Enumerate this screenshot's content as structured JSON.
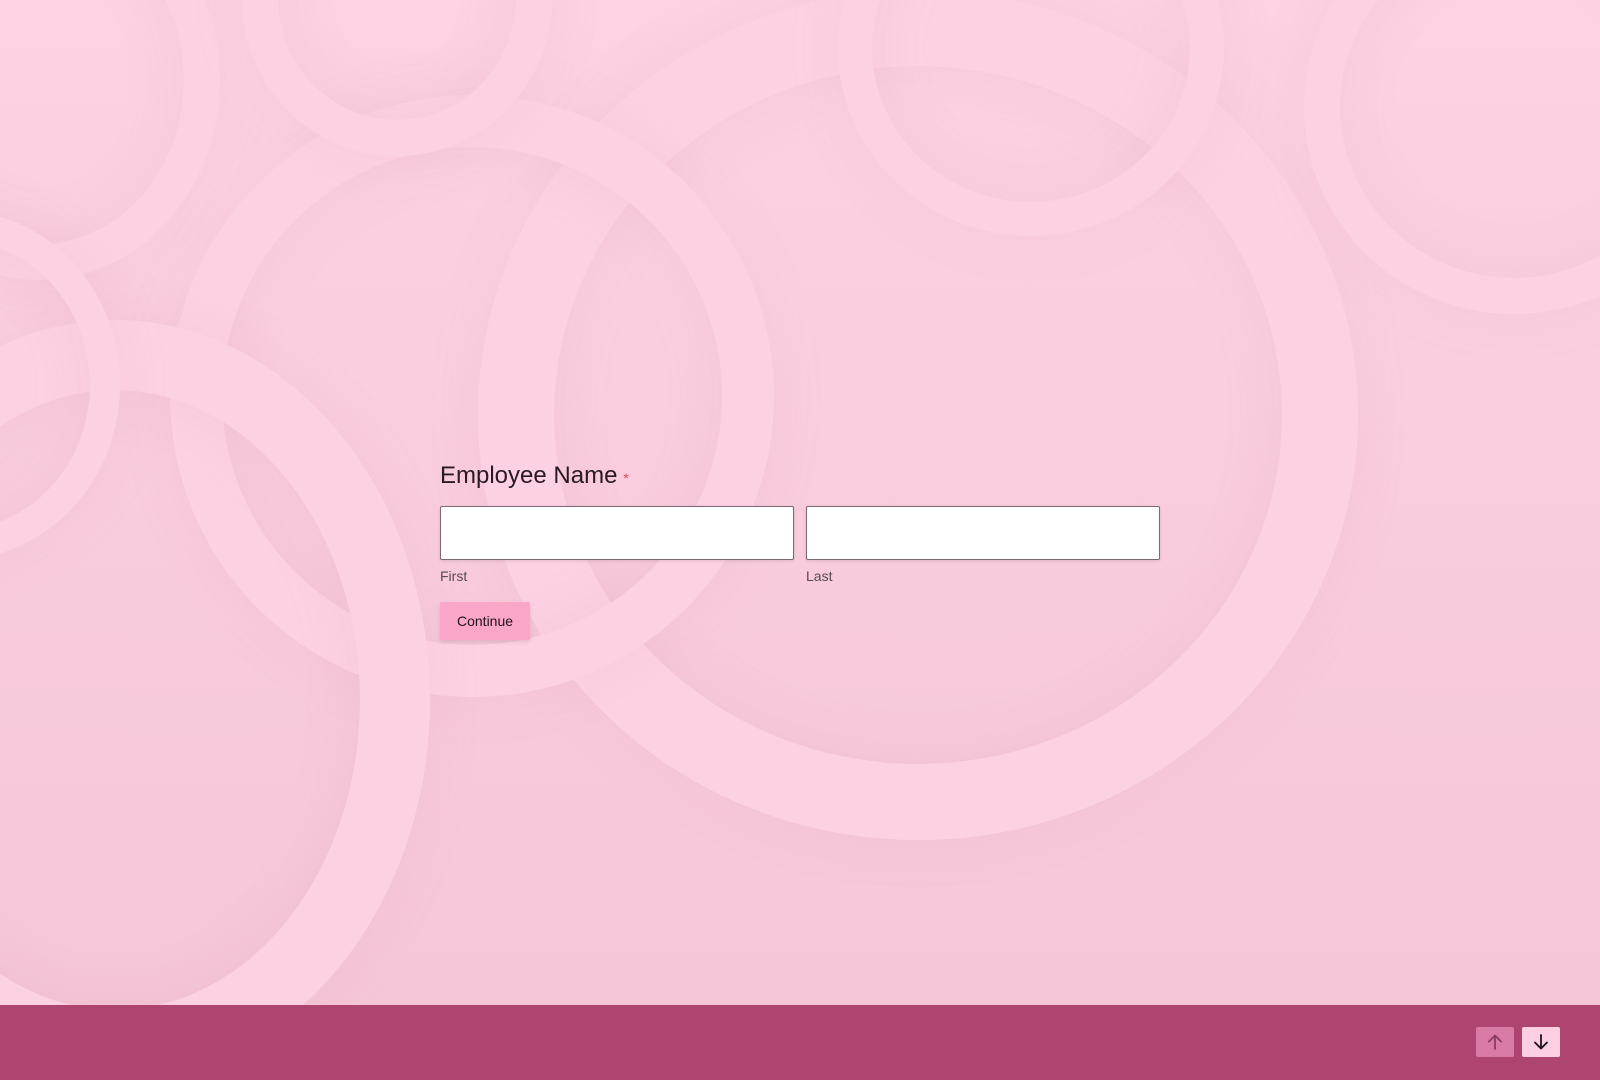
{
  "question": {
    "title": "Employee Name",
    "required_mark": "*",
    "fields": [
      {
        "sublabel": "First",
        "value": ""
      },
      {
        "sublabel": "Last",
        "value": ""
      }
    ],
    "continue_label": "Continue"
  },
  "footer": {
    "up_icon": "arrow-up-icon",
    "down_icon": "arrow-down-icon"
  },
  "colors": {
    "background": "#fcd3e5",
    "footer": "#ae4470",
    "button": "#f9a6c8",
    "required": "#e0454f"
  }
}
